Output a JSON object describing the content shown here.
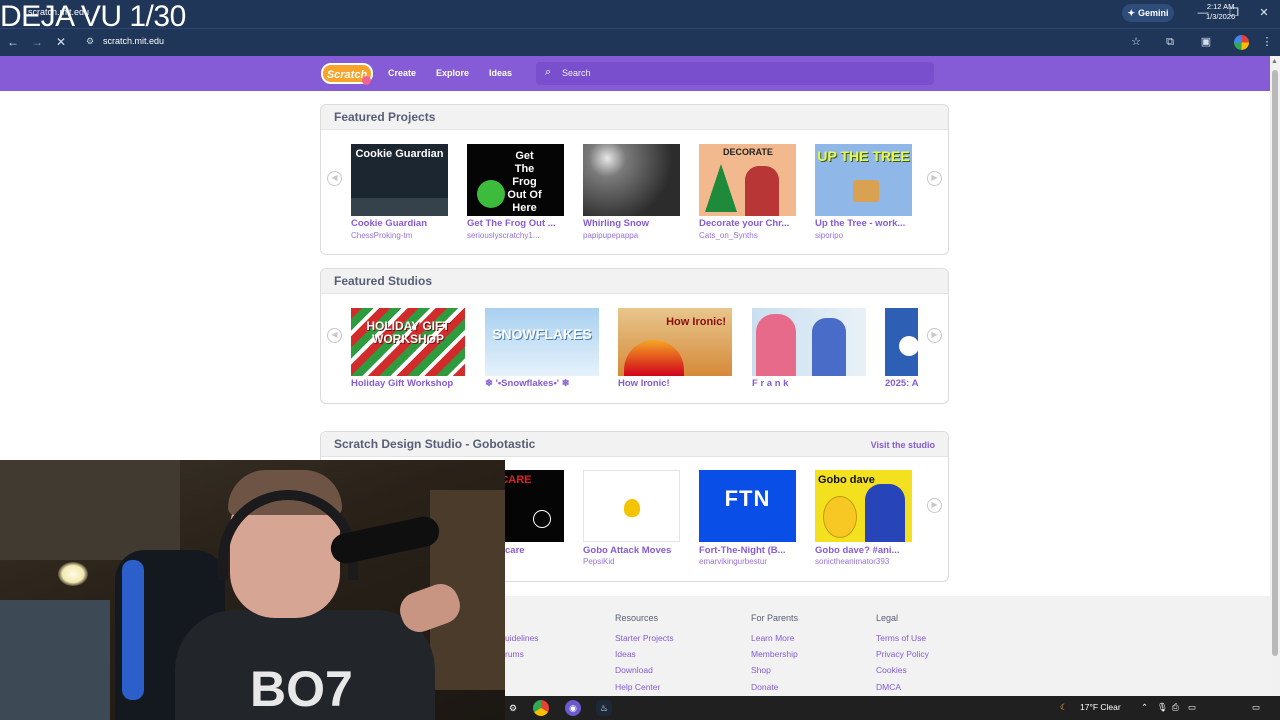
{
  "browser": {
    "overlay_title": "DEJA VU 1/30",
    "tab_title": "scratch.mit.edu",
    "url": "scratch.mit.edu",
    "gemini_label": "Gemini"
  },
  "nav": {
    "create": "Create",
    "explore": "Explore",
    "ideas": "Ideas",
    "search_placeholder": "Search",
    "logo": "Scratch"
  },
  "featured_projects": {
    "title": "Featured Projects",
    "items": [
      {
        "title": "Cookie Guardian",
        "author": "ChessProking-tm",
        "thumb_text": "Cookie Guardian"
      },
      {
        "title": "Get The Frog Out ...",
        "author": "seriouslyscratchy1...",
        "thumb_text": "Get The Frog Out Of Here"
      },
      {
        "title": "Whirling Snow",
        "author": "papipupepappa",
        "thumb_text": ""
      },
      {
        "title": "Decorate your Chr...",
        "author": "Cats_on_Synths",
        "thumb_text": "DECORATE"
      },
      {
        "title": "Up the Tree - work...",
        "author": "siporipo",
        "thumb_text": "UP THE TREE"
      }
    ]
  },
  "featured_studios": {
    "title": "Featured Studios",
    "items": [
      {
        "title": "Holiday Gift Workshop",
        "thumb_text": "HOLIDAY GIFT WORKSHOP"
      },
      {
        "title": "❄ '•Snowflakes•' ❄",
        "thumb_text": "SNOWFLAKES"
      },
      {
        "title": "How Ironic!",
        "thumb_text": "How Ironic!"
      },
      {
        "title": "F r a n k",
        "thumb_text": ""
      },
      {
        "title": "2025: A",
        "thumb_text": ""
      }
    ]
  },
  "design_studio": {
    "title": "Scratch Design Studio - Gobotastic",
    "visit_label": "Visit the studio",
    "items": [
      {
        "title": "care",
        "author": "",
        "thumb_text": "SCARE"
      },
      {
        "title": "Gobo Attack Moves",
        "author": "PepsiKid",
        "thumb_text": ""
      },
      {
        "title": "Fort-The-Night (B...",
        "author": "emarvikingurbestur",
        "thumb_text": "FTN"
      },
      {
        "title": "Gobo dave? #ani...",
        "author": "sonictheanimator393",
        "thumb_text": "Gobo dave"
      }
    ]
  },
  "footer": {
    "columns": [
      {
        "heading": "Resources",
        "links": [
          "Starter Projects",
          "Ideas",
          "Download",
          "Help Center"
        ]
      },
      {
        "heading": "For Parents",
        "links": [
          "Learn More",
          "Membership",
          "Shop",
          "Donate"
        ]
      },
      {
        "heading": "Legal",
        "links": [
          "Terms of Use",
          "Privacy Policy",
          "Cookies",
          "DMCA"
        ]
      }
    ],
    "partial_links": [
      "uidelines",
      "rums"
    ]
  },
  "webcam": {
    "shirt_text": "BO7"
  },
  "taskbar": {
    "weather": "17°F  Clear",
    "time": "2:12 AM",
    "date": "1/3/2026"
  },
  "colors": {
    "scratch_purple": "#855cd6",
    "chrome_bg": "#1f3658",
    "text_gray": "#575e75"
  }
}
